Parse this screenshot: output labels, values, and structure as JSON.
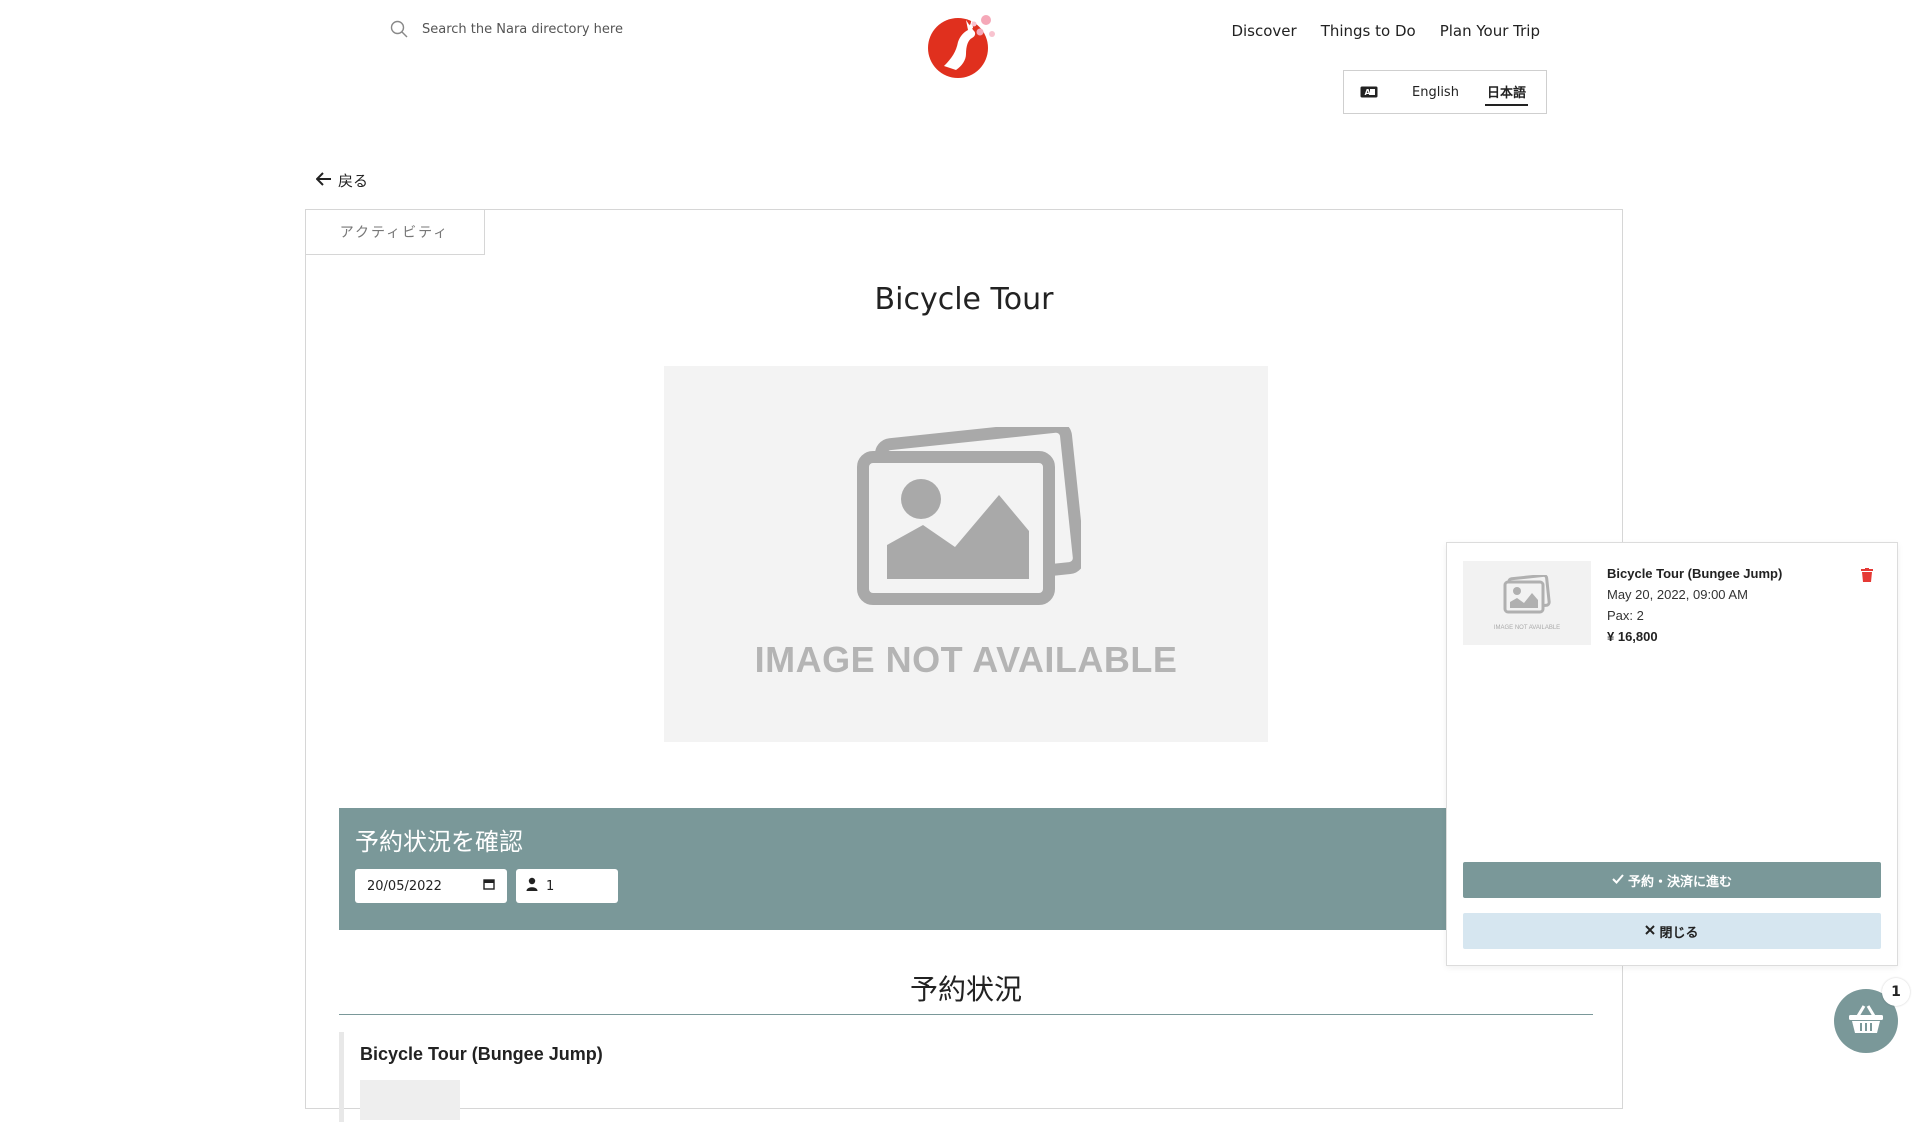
{
  "header": {
    "search_placeholder": "Search the Nara directory here",
    "nav": [
      "Discover",
      "Things to Do",
      "Plan Your Trip"
    ],
    "languages": {
      "english": "English",
      "japanese": "日本語",
      "selected": "日本語"
    }
  },
  "back_label": "戻る",
  "card": {
    "tab_label": "アクティビティ",
    "title": "Bicycle Tour",
    "image_placeholder": "IMAGE NOT AVAILABLE",
    "availability": {
      "title": "予約状況を確認",
      "date_value": "20/05/2022",
      "pax_value": "1"
    },
    "status_title": "予約状況",
    "result_title": "Bicycle Tour (Bungee Jump)"
  },
  "cart": {
    "item": {
      "name": "Bicycle Tour (Bungee Jump)",
      "datetime": "May 20, 2022, 09:00 AM",
      "pax": "Pax: 2",
      "price": "¥ 16,800",
      "thumb_text": "IMAGE NOT AVAILABLE"
    },
    "proceed_label": "予約・決済に進む",
    "close_label": "閉じる",
    "count": "1"
  },
  "colors": {
    "accent": "#7a9899",
    "close_button": "#d6e6f0",
    "trash": "#e53935",
    "logo": "#e0301e"
  }
}
